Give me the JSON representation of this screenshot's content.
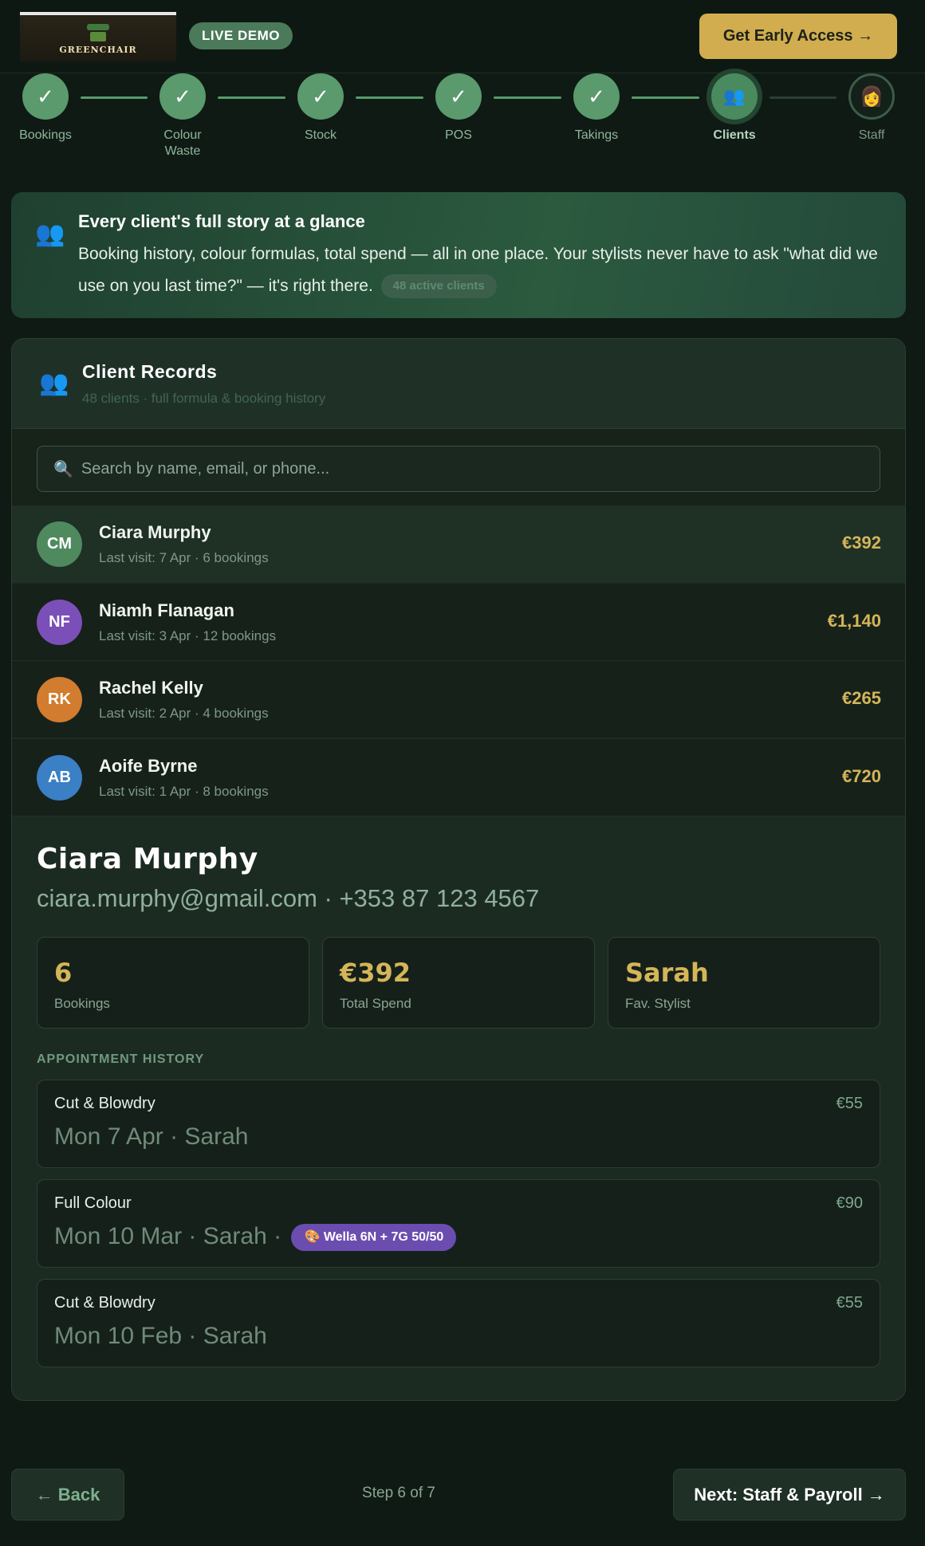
{
  "header": {
    "logo_text": "GREENCHAIR",
    "live_badge": "LIVE DEMO",
    "cta_label": "Get Early Access →"
  },
  "stepper": {
    "steps": [
      {
        "label": "Bookings",
        "state": "done",
        "glyph": "✓"
      },
      {
        "label": "Colour Waste",
        "state": "done",
        "glyph": "✓"
      },
      {
        "label": "Stock",
        "state": "done",
        "glyph": "✓"
      },
      {
        "label": "POS",
        "state": "done",
        "glyph": "✓"
      },
      {
        "label": "Takings",
        "state": "done",
        "glyph": "✓"
      },
      {
        "label": "Clients",
        "state": "active",
        "glyph": "👥"
      },
      {
        "label": "Staff",
        "state": "pending",
        "glyph": "👩"
      }
    ]
  },
  "banner": {
    "icon": "people-icon",
    "title": "Every client's full story at a glance",
    "body": "Booking history, colour formulas, total spend — all in one place. Your stylists never have to ask \"what did we use on you last time?\" — it's right there.",
    "pill": "48 active clients"
  },
  "client_records": {
    "title": "Client Records",
    "subtitle": "48 clients · full formula & booking history",
    "search_placeholder": "Search by name, email, or phone...",
    "clients": [
      {
        "initials": "CM",
        "name": "Ciara Murphy",
        "meta": "Last visit: 7 Apr · 6 bookings",
        "spend": "€392",
        "color": "#4e8a5e",
        "selected": true
      },
      {
        "initials": "NF",
        "name": "Niamh Flanagan",
        "meta": "Last visit: 3 Apr · 12 bookings",
        "spend": "€1,140",
        "color": "#7b4fb8",
        "selected": false
      },
      {
        "initials": "RK",
        "name": "Rachel Kelly",
        "meta": "Last visit: 2 Apr · 4 bookings",
        "spend": "€265",
        "color": "#d17c2e",
        "selected": false
      },
      {
        "initials": "AB",
        "name": "Aoife Byrne",
        "meta": "Last visit: 1 Apr · 8 bookings",
        "spend": "€720",
        "color": "#3b7fc4",
        "selected": false
      }
    ]
  },
  "detail": {
    "name": "Ciara Murphy",
    "contact": "ciara.murphy@gmail.com · +353 87 123 4567",
    "stats": [
      {
        "value": "6",
        "label": "Bookings"
      },
      {
        "value": "€392",
        "label": "Total Spend"
      },
      {
        "value": "Sarah",
        "label": "Fav. Stylist"
      }
    ],
    "history_title": "APPOINTMENT HISTORY",
    "appointments": [
      {
        "service": "Cut & Blowdry",
        "price": "€55",
        "when": "Mon 7 Apr · Sarah",
        "formula": ""
      },
      {
        "service": "Full Colour",
        "price": "€90",
        "when": "Mon 10 Mar · Sarah ·",
        "formula": "🎨 Wella 6N + 7G 50/50"
      },
      {
        "service": "Cut & Blowdry",
        "price": "€55",
        "when": "Mon 10 Feb · Sarah",
        "formula": ""
      }
    ]
  },
  "footer": {
    "back_label": "← Back",
    "step_text": "Step 6 of 7",
    "next_label": "Next: Staff & Payroll →"
  }
}
